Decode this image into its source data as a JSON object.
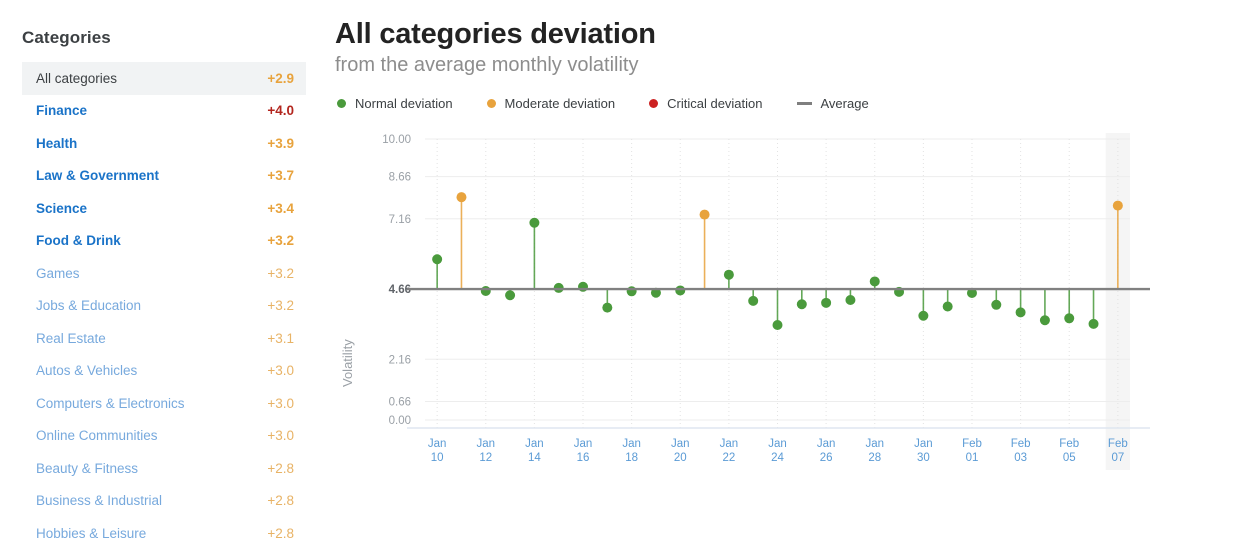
{
  "sidebar": {
    "title": "Categories",
    "items": [
      {
        "label": "All categories",
        "value": "+2.9",
        "style": "selected"
      },
      {
        "label": "Finance",
        "value": "+4.0",
        "style": "strong",
        "value_color": "red"
      },
      {
        "label": "Health",
        "value": "+3.9",
        "style": "strong",
        "value_color": "orange"
      },
      {
        "label": "Law & Government",
        "value": "+3.7",
        "style": "strong",
        "value_color": "orange"
      },
      {
        "label": "Science",
        "value": "+3.4",
        "style": "strong",
        "value_color": "orange"
      },
      {
        "label": "Food & Drink",
        "value": "+3.2",
        "style": "strong",
        "value_color": "orange"
      },
      {
        "label": "Games",
        "value": "+3.2",
        "style": "soft"
      },
      {
        "label": "Jobs & Education",
        "value": "+3.2",
        "style": "soft"
      },
      {
        "label": "Real Estate",
        "value": "+3.1",
        "style": "soft"
      },
      {
        "label": "Autos & Vehicles",
        "value": "+3.0",
        "style": "soft"
      },
      {
        "label": "Computers & Electronics",
        "value": "+3.0",
        "style": "soft"
      },
      {
        "label": "Online Communities",
        "value": "+3.0",
        "style": "soft"
      },
      {
        "label": "Beauty & Fitness",
        "value": "+2.8",
        "style": "soft"
      },
      {
        "label": "Business & Industrial",
        "value": "+2.8",
        "style": "soft"
      },
      {
        "label": "Hobbies & Leisure",
        "value": "+2.8",
        "style": "soft"
      }
    ]
  },
  "chart": {
    "title": "All categories deviation",
    "subtitle": "from the average monthly volatility",
    "legend": [
      {
        "label": "Normal deviation",
        "color": "#4a9a3c",
        "marker": "dot"
      },
      {
        "label": "Moderate deviation",
        "color": "#e8a33d",
        "marker": "dot"
      },
      {
        "label": "Critical deviation",
        "color": "#cc2222",
        "marker": "dot"
      },
      {
        "label": "Average",
        "color": "#7f7f7f",
        "marker": "dash"
      }
    ]
  },
  "chart_data": {
    "type": "scatter",
    "title": "All categories deviation",
    "subtitle": "from the average monthly volatility",
    "xlabel": "",
    "ylabel": "Volatility",
    "ylim": [
      0.0,
      10.0
    ],
    "ytick_values": [
      10.0,
      8.66,
      7.16,
      4.66,
      2.16,
      0.66,
      0.0
    ],
    "ytick_labels": [
      "10.00",
      "8.66",
      "7.16",
      "4.66",
      "2.16",
      "0.66",
      "0.00"
    ],
    "average": 4.66,
    "average_label": "Average",
    "grid": true,
    "legend_position": "top-left",
    "highlight_band": {
      "from": "Feb 07",
      "to": "Feb 07",
      "color": "#f1f1f1"
    },
    "categories": [
      "Jan 10",
      "Jan 11",
      "Jan 12",
      "Jan 13",
      "Jan 14",
      "Jan 15",
      "Jan 16",
      "Jan 17",
      "Jan 18",
      "Jan 19",
      "Jan 20",
      "Jan 21",
      "Jan 22",
      "Jan 23",
      "Jan 24",
      "Jan 25",
      "Jan 26",
      "Jan 27",
      "Jan 28",
      "Jan 29",
      "Jan 30",
      "Jan 31",
      "Feb 01",
      "Feb 02",
      "Feb 03",
      "Feb 04",
      "Feb 05",
      "Feb 06",
      "Feb 07"
    ],
    "xtick_labels": [
      "Jan 10",
      "Jan 12",
      "Jan 14",
      "Jan 16",
      "Jan 18",
      "Jan 20",
      "Jan 22",
      "Jan 24",
      "Jan 26",
      "Jan 28",
      "Jan 30",
      "Feb 01",
      "Feb 03",
      "Feb 05",
      "Feb 07"
    ],
    "points": [
      {
        "x": "Jan 10",
        "y": 5.72,
        "severity": "normal"
      },
      {
        "x": "Jan 11",
        "y": 7.93,
        "severity": "moderate"
      },
      {
        "x": "Jan 12",
        "y": 4.59,
        "severity": "normal"
      },
      {
        "x": "Jan 13",
        "y": 4.44,
        "severity": "normal"
      },
      {
        "x": "Jan 14",
        "y": 7.02,
        "severity": "normal"
      },
      {
        "x": "Jan 15",
        "y": 4.7,
        "severity": "normal"
      },
      {
        "x": "Jan 16",
        "y": 4.74,
        "severity": "normal"
      },
      {
        "x": "Jan 17",
        "y": 4.0,
        "severity": "normal"
      },
      {
        "x": "Jan 18",
        "y": 4.58,
        "severity": "normal"
      },
      {
        "x": "Jan 19",
        "y": 4.53,
        "severity": "normal"
      },
      {
        "x": "Jan 20",
        "y": 4.61,
        "severity": "normal"
      },
      {
        "x": "Jan 21",
        "y": 7.31,
        "severity": "moderate"
      },
      {
        "x": "Jan 22",
        "y": 5.17,
        "severity": "normal"
      },
      {
        "x": "Jan 23",
        "y": 4.24,
        "severity": "normal"
      },
      {
        "x": "Jan 24",
        "y": 3.38,
        "severity": "normal"
      },
      {
        "x": "Jan 25",
        "y": 4.12,
        "severity": "normal"
      },
      {
        "x": "Jan 26",
        "y": 4.17,
        "severity": "normal"
      },
      {
        "x": "Jan 27",
        "y": 4.27,
        "severity": "normal"
      },
      {
        "x": "Jan 28",
        "y": 4.93,
        "severity": "normal"
      },
      {
        "x": "Jan 29",
        "y": 4.56,
        "severity": "normal"
      },
      {
        "x": "Jan 30",
        "y": 3.71,
        "severity": "normal"
      },
      {
        "x": "Jan 31",
        "y": 4.04,
        "severity": "normal"
      },
      {
        "x": "Feb 01",
        "y": 4.52,
        "severity": "normal"
      },
      {
        "x": "Feb 02",
        "y": 4.1,
        "severity": "normal"
      },
      {
        "x": "Feb 03",
        "y": 3.83,
        "severity": "normal"
      },
      {
        "x": "Feb 04",
        "y": 3.55,
        "severity": "normal"
      },
      {
        "x": "Feb 05",
        "y": 3.62,
        "severity": "normal"
      },
      {
        "x": "Feb 06",
        "y": 3.42,
        "severity": "normal"
      },
      {
        "x": "Feb 07",
        "y": 7.63,
        "severity": "moderate"
      }
    ],
    "severity_colors": {
      "normal": "#4a9a3c",
      "moderate": "#e8a33d",
      "critical": "#cc2222"
    }
  }
}
